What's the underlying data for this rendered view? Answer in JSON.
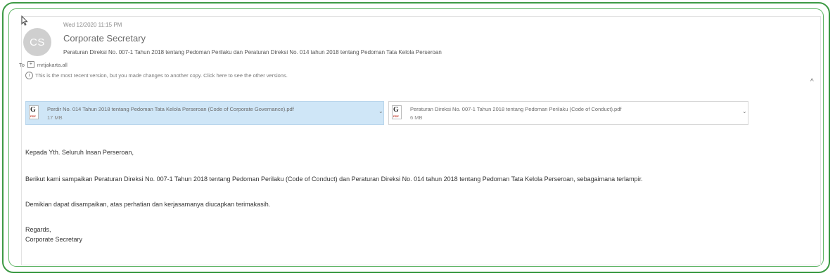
{
  "email": {
    "avatar_initials": "CS",
    "datetime": "Wed 12/2020 11:15 PM",
    "sender": "Corporate Secretary",
    "subject": "Peraturan Direksi No. 007-1 Tahun 2018 tentang Pedoman Perilaku dan Peraturan Direksi No. 014 tahun 2018 tentang Pedoman Tata Kelola Perseroan",
    "to_prefix": "To",
    "recipient": "mrtjakarta.all",
    "info_message": "This is the most recent version, but you made changes to another copy. Click here to see the other versions.",
    "attachments": [
      {
        "name": "Perdir No. 014 Tahun 2018 tentang Pedoman Tata Kelola Perseroan (Code of Corporate Governance).pdf",
        "size": "17 MB",
        "selected": true
      },
      {
        "name": "Peraturan Direksi No. 007-1 Tahun 2018 tentang Pedoman Perilaku (Code of Conduct).pdf",
        "size": "6 MB",
        "selected": false
      }
    ],
    "body": {
      "greeting": "Kepada Yth. Seluruh Insan Perseroan,",
      "paragraph1": "Berikut kami sampaikan Peraturan Direksi No. 007-1 Tahun 2018 tentang Pedoman Perilaku (Code of Conduct) dan Peraturan Direksi No. 014 tahun 2018 tentang Pedoman Tata Kelola Perseroan, sebagaimana terlampir.",
      "paragraph2": "Demikian dapat disampaikan, atas perhatian dan kerjasamanya diucapkan terimakasih.",
      "closing": "Regards,",
      "signature": "Corporate Secretary"
    }
  },
  "icons": {
    "cursor": "mouse-pointer-icon",
    "info": "info-icon",
    "expand": "plus-box-icon",
    "collapse": "chevron-up-icon",
    "attachment": "pdf-file-icon",
    "attachment_menu": "chevron-down-icon"
  },
  "colors": {
    "frame": "#3d9a45",
    "selected_attachment": "#cfe6f7",
    "avatar": "#cfcfcf"
  }
}
